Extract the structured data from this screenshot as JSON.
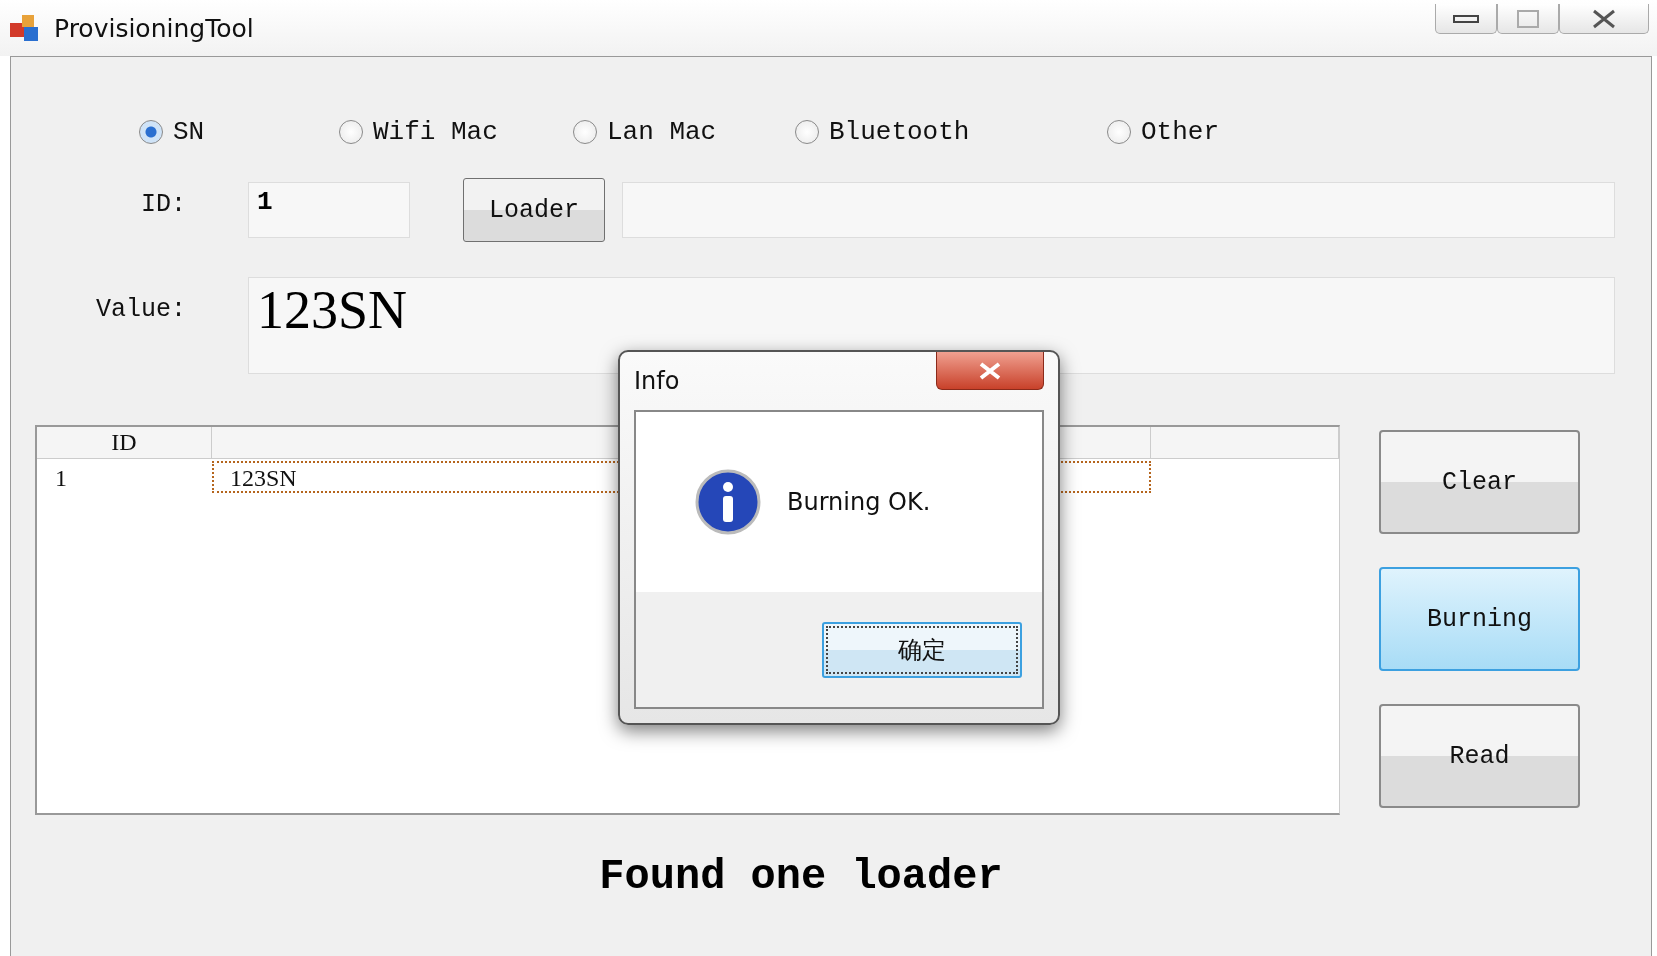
{
  "window": {
    "title": "ProvisioningTool"
  },
  "radios": [
    {
      "label": "SN",
      "selected": true
    },
    {
      "label": "Wifi Mac",
      "selected": false
    },
    {
      "label": "Lan Mac",
      "selected": false
    },
    {
      "label": "Bluetooth",
      "selected": false
    },
    {
      "label": "Other",
      "selected": false
    }
  ],
  "id_field": {
    "label": "ID:",
    "value": "1"
  },
  "loader_button": "Loader",
  "value_field": {
    "label": "Value:",
    "value": "123SN"
  },
  "table": {
    "columns": [
      "ID"
    ],
    "rows": [
      {
        "cells": [
          "1",
          "123SN"
        ],
        "selected": true
      }
    ]
  },
  "buttons": [
    {
      "label": "Clear",
      "highlighted": false
    },
    {
      "label": "Burning",
      "highlighted": true
    },
    {
      "label": "Read",
      "highlighted": false
    }
  ],
  "status": "Found one loader",
  "dialog": {
    "title": "Info",
    "message": "Burning OK.",
    "button": "确定"
  }
}
